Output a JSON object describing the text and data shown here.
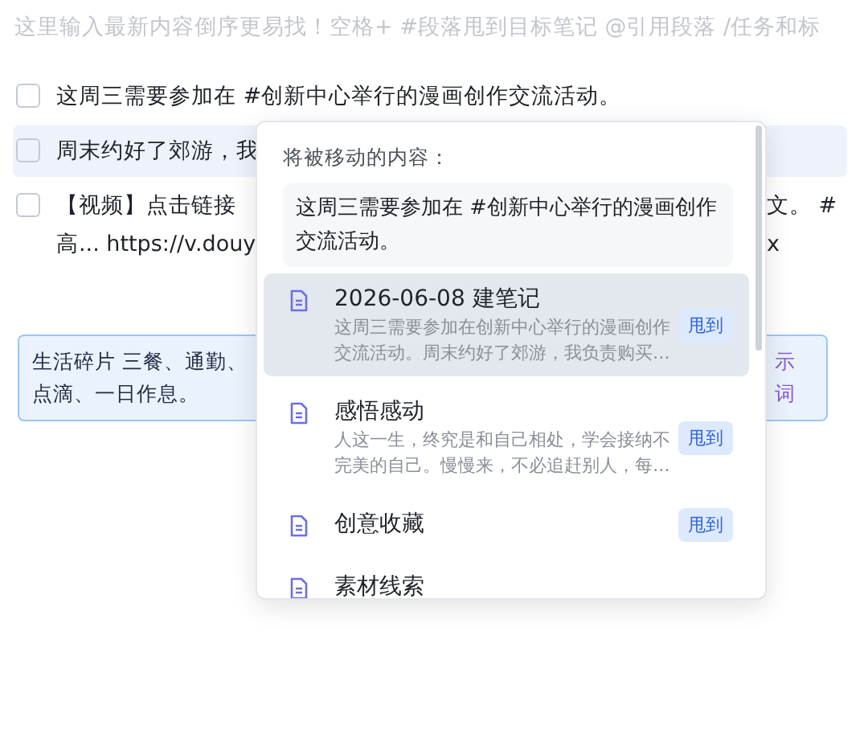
{
  "editor": {
    "placeholder": "这里输入最新内容倒序更易找！空格+ #段落甩到目标笔记 @引用段落 /任务和标"
  },
  "tasks": [
    {
      "checked": false,
      "selected": false,
      "left_lines": [
        "这周三需要参加在 #创新中心举行的漫画创作交流活动。"
      ]
    },
    {
      "checked": false,
      "selected": true,
      "left_lines": [
        "周末约好了郊游，我"
      ]
    },
    {
      "checked": false,
      "selected": false,
      "left_lines": [
        "【视频】点击链接",
        "高... https://v.douy"
      ],
      "right_lines": [
        "文。 #",
        "x"
      ]
    }
  ],
  "cards": [
    {
      "text": "生活碎片 三餐、通勤、点滴、一日作息。"
    },
    {
      "text": "示词"
    }
  ],
  "move_popup": {
    "heading": "将被移动的内容：",
    "quote": "这周三需要参加在 #创新中心举行的漫画创作交流活动。",
    "notes": [
      {
        "title": "2026-06-08 建笔记",
        "snippet": "这周三需要参加在创新中心举行的漫画创作交流活动。周末约好了郊游，我负责购买…",
        "action": "甩到",
        "selected": true
      },
      {
        "title": "感悟感动",
        "snippet": "人这一生，终究是和自己相处，学会接纳不完美的自己。慢慢来，不必追赶别人，每…",
        "action": "甩到",
        "selected": false
      },
      {
        "title": "创意收藏",
        "action": "甩到",
        "selected": false
      },
      {
        "title": "素材线索",
        "selected": false
      }
    ]
  }
}
